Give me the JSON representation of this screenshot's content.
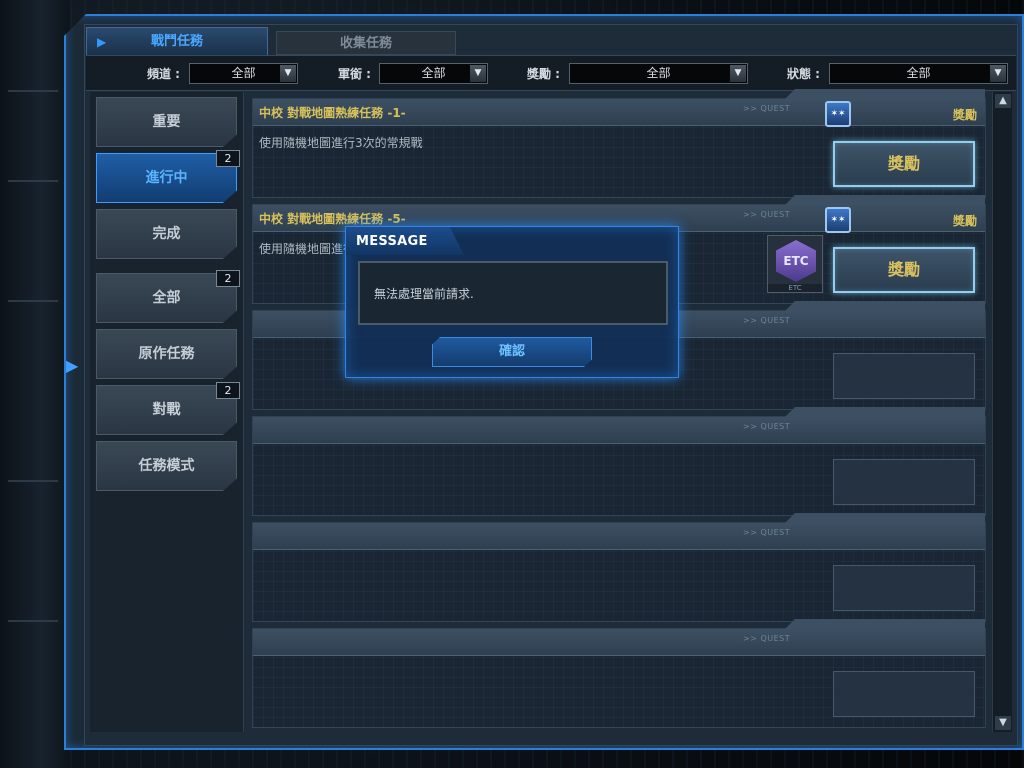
{
  "tabs": [
    {
      "label": "戰鬥任務",
      "active": true
    },
    {
      "label": "收集任務",
      "active": false
    }
  ],
  "filters": [
    {
      "label": "頻道 :",
      "value": "全部"
    },
    {
      "label": "軍銜 :",
      "value": "全部"
    },
    {
      "label": "獎勵 :",
      "value": "全部"
    },
    {
      "label": "狀態 :",
      "value": "全部"
    }
  ],
  "sidebar": {
    "items": [
      {
        "label": "重要",
        "badge": ""
      },
      {
        "label": "進行中",
        "badge": "2",
        "active": true
      },
      {
        "label": "完成",
        "badge": ""
      },
      {
        "label": "全部",
        "badge": "2"
      },
      {
        "label": "原作任務",
        "badge": ""
      },
      {
        "label": "對戰",
        "badge": "2"
      },
      {
        "label": "任務模式",
        "badge": ""
      }
    ]
  },
  "quests": [
    {
      "title": "中校 對戰地圖熟練任務 -1-",
      "description": "使用隨機地圖進行3次的常規戰",
      "reward_label": "獎勵",
      "reward_button": "獎勵",
      "tag": ">> QUEST"
    },
    {
      "title": "中校 對戰地圖熟練任務 -5-",
      "description": "使用隨機地圖進行",
      "reward_label": "獎勵",
      "reward_button": "獎勵",
      "tag": ">> QUEST",
      "item_icon": "ETC",
      "item_caption": "ETC"
    },
    {
      "tag": ">> QUEST"
    },
    {
      "tag": ">> QUEST"
    },
    {
      "tag": ">> QUEST"
    },
    {
      "tag": ">> QUEST"
    }
  ],
  "dialog": {
    "title": "MESSAGE",
    "message": "無法處理當前請求.",
    "confirm_label": "確認"
  },
  "colors": {
    "accent_blue": "#2b7fd9",
    "gold_text": "#d8c15a",
    "panel_bg": "#1e2b39"
  }
}
